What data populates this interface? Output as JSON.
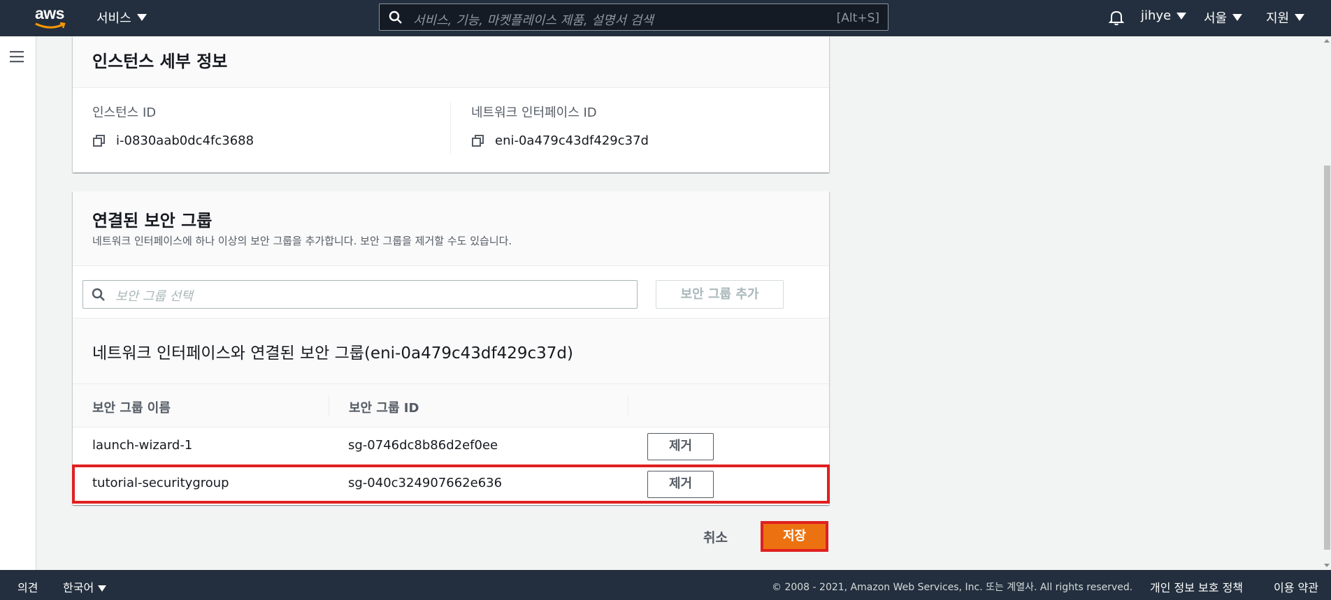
{
  "topnav": {
    "logo": "aws",
    "services_label": "서비스",
    "search_placeholder": "서비스, 기능, 마켓플레이스 제품, 설명서 검색",
    "search_hint": "[Alt+S]",
    "user": "jihye",
    "region": "서울",
    "support": "지원"
  },
  "details": {
    "title": "인스턴스 세부 정보",
    "instance_id_label": "인스턴스 ID",
    "instance_id": "i-0830aab0dc4fc3688",
    "eni_label": "네트워크 인터페이스 ID",
    "eni_id": "eni-0a479c43df429c37d"
  },
  "security": {
    "title": "연결된 보안 그룹",
    "description": "네트워크 인터페이스에 하나 이상의 보안 그룹을 추가합니다. 보안 그룹을 제거할 수도 있습니다.",
    "search_placeholder": "보안 그룹 선택",
    "add_button": "보안 그룹 추가",
    "table_title": "네트워크 인터페이스와 연결된 보안 그룹(eni-0a479c43df429c37d)",
    "columns": [
      "보안 그룹 이름",
      "보안 그룹 ID"
    ],
    "rows": [
      {
        "name": "launch-wizard-1",
        "id": "sg-0746dc8b86d2ef0ee",
        "action": "제거"
      },
      {
        "name": "tutorial-securitygroup",
        "id": "sg-040c324907662e636",
        "action": "제거"
      }
    ]
  },
  "actions": {
    "cancel": "취소",
    "save": "저장"
  },
  "footer": {
    "feedback": "의견",
    "language": "한국어",
    "copyright": "© 2008 - 2021, Amazon Web Services, Inc. 또는 계열사. All rights reserved.",
    "privacy": "개인 정보 보호 정책",
    "terms": "이용 약관"
  },
  "colors": {
    "nav_bg": "#232f3e",
    "primary_button": "#ec7211",
    "highlight_outline": "#e02020"
  }
}
